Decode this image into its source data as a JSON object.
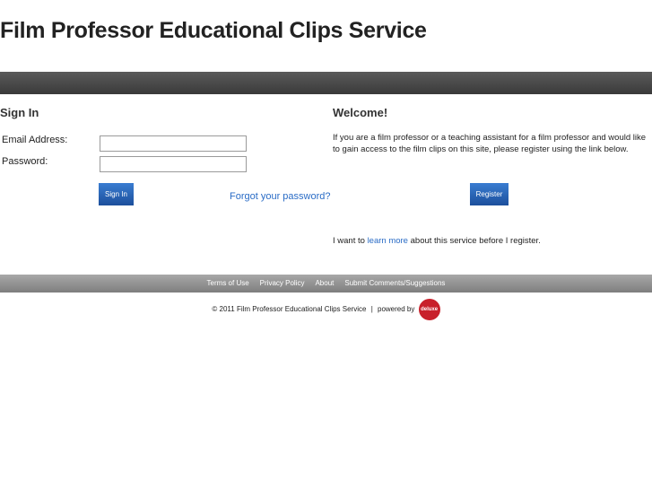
{
  "header": {
    "site_title": "Film Professor Educational Clips Service"
  },
  "signin": {
    "title": "Sign In",
    "email_label": "Email Address:",
    "email_value": "",
    "password_label": "Password:",
    "password_value": "",
    "signin_button": "Sign In",
    "forgot_link": "Forgot your password?"
  },
  "welcome": {
    "title": "Welcome!",
    "text": "If you are a film professor or a teaching assistant for a film professor and would like to gain access to the film clips on this site, please register using the link below.",
    "register_button": "Register",
    "learn_prefix": "I want to ",
    "learn_link": "learn more",
    "learn_suffix": " about this service before I register."
  },
  "footer": {
    "links": [
      "Terms of Use",
      "Privacy Policy",
      "About",
      "Submit Comments/Suggestions"
    ],
    "copyright": "© 2011 Film Professor Educational Clips Service",
    "separator": "|",
    "powered_by": "powered by",
    "logo_text": "deluxe"
  },
  "colors": {
    "link": "#2a6cc6",
    "button": "#1c4f9c",
    "top_bar": "#3a3a3a",
    "footer_bar": "#8a8a8a",
    "logo": "#c8202b"
  }
}
